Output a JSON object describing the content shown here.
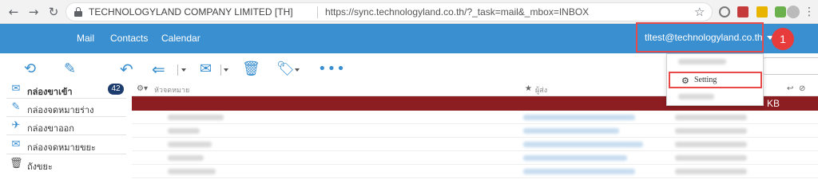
{
  "browser": {
    "site_name": "TECHNOLOGYLAND COMPANY LIMITED [TH]",
    "url": "https://sync.technologyland.co.th/?_task=mail&_mbox=INBOX",
    "back_icon": "←",
    "forward_icon": "→",
    "reload_icon": "↻",
    "star_icon": "☆"
  },
  "header": {
    "menu": [
      "Mail",
      "Contacts",
      "Calendar"
    ],
    "account": "tltest@technologyland.co.th",
    "callout_number": "1"
  },
  "dropdown": {
    "setting_label": "Setting"
  },
  "sidebar": {
    "folders": [
      {
        "label": "กล่องขาเข้า",
        "count": "42",
        "icon": "inbox-icon"
      },
      {
        "label": "กล่องจดหมายร่าง",
        "icon": "pencil-icon"
      },
      {
        "label": "กล่องขาออก",
        "icon": "outbox-icon"
      },
      {
        "label": "กล่องจดหมายขยะ",
        "icon": "junk-icon"
      },
      {
        "label": "ถังขยะ",
        "icon": "trash-icon"
      }
    ]
  },
  "list": {
    "col_subject": "หัวจดหมาย",
    "col_sender": "ผู้ส่ง",
    "selected_row_size": "KB"
  },
  "colors": {
    "header_bg": "#3a8fd0",
    "selected_row": "#8c1e22",
    "highlight": "#e84a4a"
  }
}
